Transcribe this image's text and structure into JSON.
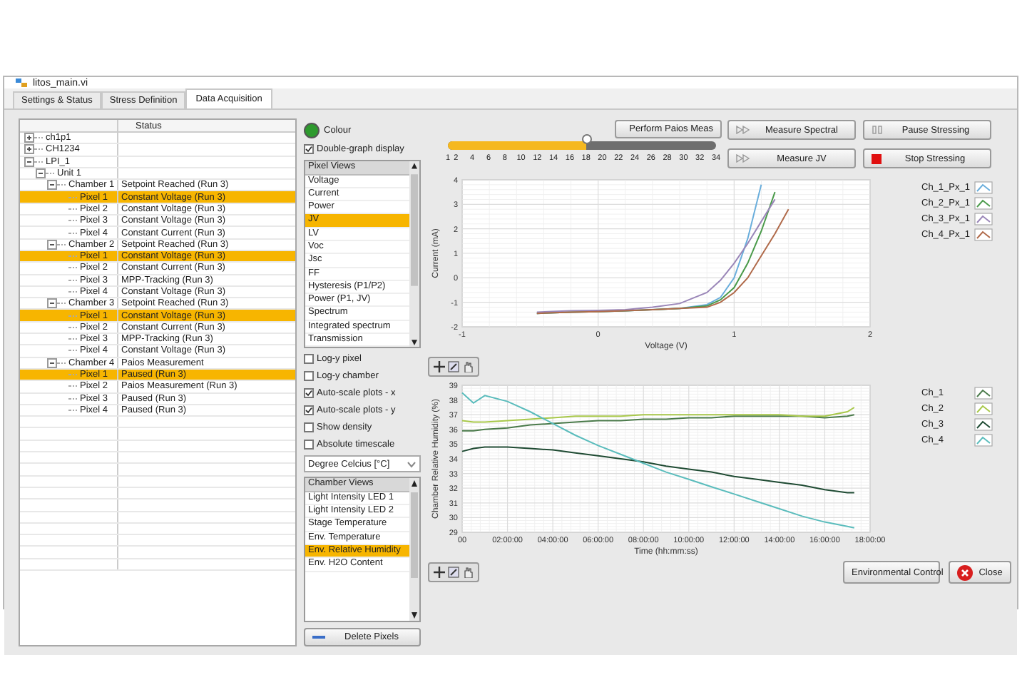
{
  "window": {
    "title": "litos_main.vi"
  },
  "tabs": [
    {
      "label": "Settings & Status",
      "selected": false
    },
    {
      "label": "Stress Definition",
      "selected": false
    },
    {
      "label": "Data Acquisition",
      "selected": true
    }
  ],
  "tree": {
    "columns": [
      "Status"
    ],
    "rows": [
      {
        "label": "ch1p1",
        "expanded": false,
        "selected": false
      },
      {
        "label": "CH1234",
        "expanded": false,
        "selected": false
      },
      {
        "label": "LPI_1",
        "expanded": true,
        "selected": false,
        "children": [
          {
            "label": "Unit 1",
            "expanded": true,
            "selected": false,
            "children": [
              {
                "label": "Chamber 1",
                "status": "Setpoint Reached (Run 3)",
                "expanded": true,
                "selected": false,
                "children": [
                  {
                    "label": "Pixel 1",
                    "status": "Constant Voltage (Run 3)",
                    "selected": true
                  },
                  {
                    "label": "Pixel 2",
                    "status": "Constant Voltage (Run 3)",
                    "selected": false
                  },
                  {
                    "label": "Pixel 3",
                    "status": "Constant Voltage (Run 3)",
                    "selected": false
                  },
                  {
                    "label": "Pixel 4",
                    "status": "Constant Current (Run 3)",
                    "selected": false
                  }
                ]
              },
              {
                "label": "Chamber 2",
                "status": "Setpoint Reached (Run 3)",
                "expanded": true,
                "selected": false,
                "children": [
                  {
                    "label": "Pixel 1",
                    "status": "Constant Voltage (Run 3)",
                    "selected": true
                  },
                  {
                    "label": "Pixel 2",
                    "status": "Constant Current (Run 3)",
                    "selected": false
                  },
                  {
                    "label": "Pixel 3",
                    "status": "MPP-Tracking (Run 3)",
                    "selected": false
                  },
                  {
                    "label": "Pixel 4",
                    "status": "Constant Voltage (Run 3)",
                    "selected": false
                  }
                ]
              },
              {
                "label": "Chamber 3",
                "status": "Setpoint Reached (Run 3)",
                "expanded": true,
                "selected": false,
                "children": [
                  {
                    "label": "Pixel 1",
                    "status": "Constant Voltage (Run 3)",
                    "selected": true
                  },
                  {
                    "label": "Pixel 2",
                    "status": "Constant Current (Run 3)",
                    "selected": false
                  },
                  {
                    "label": "Pixel 3",
                    "status": "MPP-Tracking (Run 3)",
                    "selected": false
                  },
                  {
                    "label": "Pixel 4",
                    "status": "Constant Voltage (Run 3)",
                    "selected": false
                  }
                ]
              },
              {
                "label": "Chamber 4",
                "status": "Paios Measurement",
                "expanded": true,
                "selected": false,
                "children": [
                  {
                    "label": "Pixel 1",
                    "status": "Paused (Run 3)",
                    "selected": true
                  },
                  {
                    "label": "Pixel 2",
                    "status": "Paios Measurement (Run 3)",
                    "selected": false
                  },
                  {
                    "label": "Pixel 3",
                    "status": "Paused (Run 3)",
                    "selected": false
                  },
                  {
                    "label": "Pixel 4",
                    "status": "Paused (Run 3)",
                    "selected": false
                  }
                ]
              }
            ]
          }
        ]
      }
    ]
  },
  "colour_indicator": {
    "label": "Colour",
    "on": true
  },
  "double_graph": {
    "label": "Double-graph display",
    "checked": true
  },
  "pixel_views": {
    "title": "Pixel Views",
    "items": [
      {
        "label": "Voltage",
        "selected": false
      },
      {
        "label": "Current",
        "selected": false
      },
      {
        "label": "Power",
        "selected": false
      },
      {
        "label": "JV",
        "selected": true
      },
      {
        "label": "LV",
        "selected": false
      },
      {
        "label": "Voc",
        "selected": false
      },
      {
        "label": "Jsc",
        "selected": false
      },
      {
        "label": "FF",
        "selected": false
      },
      {
        "label": "Hysteresis (P1/P2)",
        "selected": false
      },
      {
        "label": "Power (P1, JV)",
        "selected": false
      },
      {
        "label": "Spectrum",
        "selected": false
      },
      {
        "label": "Integrated spectrum",
        "selected": false
      },
      {
        "label": "Transmission",
        "selected": false
      }
    ]
  },
  "options": [
    {
      "label": "Log-y pixel",
      "checked": false
    },
    {
      "label": "Log-y chamber",
      "checked": false
    },
    {
      "label": "Auto-scale plots - x",
      "checked": true
    },
    {
      "label": "Auto-scale plots - y",
      "checked": true
    },
    {
      "label": "Show density",
      "checked": false
    },
    {
      "label": "Absolute timescale",
      "checked": false
    }
  ],
  "unit_dropdown": {
    "value": "Degree Celcius [°C]"
  },
  "chamber_views": {
    "title": "Chamber Views",
    "items": [
      {
        "label": "Light Intensity LED 1",
        "selected": false
      },
      {
        "label": "Light Intensity LED 2",
        "selected": false
      },
      {
        "label": "Stage Temperature",
        "selected": false
      },
      {
        "label": "Env. Temperature",
        "selected": false
      },
      {
        "label": "Env. Relative Humidity",
        "selected": true
      },
      {
        "label": "Env. H2O Content",
        "selected": false
      }
    ]
  },
  "delete_button": "Delete Pixels",
  "run_slider": {
    "level": 0.515,
    "ticks": [
      "1",
      "2",
      "4",
      "6",
      "8",
      "10",
      "12",
      "14",
      "16",
      "18",
      "20",
      "22",
      "24",
      "26",
      "28",
      "30",
      "32",
      "34"
    ]
  },
  "buttons": [
    {
      "label": "Perform Paios Meas",
      "kind": "paios"
    },
    {
      "label": "Measure Spectral",
      "kind": "measure"
    },
    {
      "label": "Pause Stressing",
      "kind": "pause"
    },
    {
      "label": "Measure JV",
      "kind": "measure"
    },
    {
      "label": "Stop Stressing",
      "kind": "stop"
    }
  ],
  "jv_graph": {
    "chart_data": {
      "type": "line",
      "grid": true,
      "xlabel": "Voltage (V)",
      "ylabel": "Current  (mA)",
      "x": [
        -0.45,
        -0.2,
        0,
        0.2,
        0.4,
        0.6,
        0.8,
        0.9,
        1.0,
        1.1,
        1.2,
        1.3,
        1.4
      ],
      "xlim": [
        -1,
        2
      ],
      "ylim": [
        -2,
        4
      ],
      "xticks": [
        -1,
        0,
        1,
        2
      ],
      "yticks": [
        -2,
        -1,
        0,
        1,
        2,
        3,
        4
      ],
      "series": [
        {
          "name": "Ch_1_Px_1",
          "color": "#6aaedc",
          "values": [
            -1.45,
            -1.4,
            -1.38,
            -1.35,
            -1.3,
            -1.25,
            -1.1,
            -0.8,
            0.0,
            1.6,
            3.8,
            null,
            null
          ]
        },
        {
          "name": "Ch_2_Px_1",
          "color": "#4a9a4a",
          "values": [
            -1.45,
            -1.4,
            -1.38,
            -1.35,
            -1.3,
            -1.25,
            -1.15,
            -0.9,
            -0.4,
            0.6,
            1.9,
            3.5,
            null
          ]
        },
        {
          "name": "Ch_3_Px_1",
          "color": "#9a86b8",
          "values": [
            -1.4,
            -1.35,
            -1.33,
            -1.3,
            -1.2,
            -1.05,
            -0.6,
            -0.1,
            0.6,
            1.4,
            2.3,
            3.2,
            null
          ]
        },
        {
          "name": "Ch_4_Px_1",
          "color": "#b06a4a",
          "values": [
            -1.45,
            -1.4,
            -1.38,
            -1.35,
            -1.3,
            -1.25,
            -1.2,
            -1.0,
            -0.6,
            0.0,
            0.9,
            1.8,
            2.8
          ]
        }
      ]
    }
  },
  "humidity_graph": {
    "chart_data": {
      "type": "line",
      "grid": true,
      "xlabel": "Time (hh:mm:ss)",
      "ylabel": "Chamber Relative Humidity (%)",
      "x": [
        0,
        0.5,
        1,
        2,
        3,
        4,
        5,
        6,
        7,
        8,
        9,
        10,
        11,
        12,
        13,
        14,
        15,
        16,
        17,
        17.3
      ],
      "xlim": [
        0,
        18
      ],
      "ylim": [
        29,
        39
      ],
      "xticks": [
        {
          "value": 0,
          "label": "00"
        },
        {
          "value": 2,
          "label": "02:00:00"
        },
        {
          "value": 4,
          "label": "04:00:00"
        },
        {
          "value": 6,
          "label": "06:00:00"
        },
        {
          "value": 8,
          "label": "08:00:00"
        },
        {
          "value": 10,
          "label": "10:00:00"
        },
        {
          "value": 12,
          "label": "12:00:00"
        },
        {
          "value": 14,
          "label": "14:00:00"
        },
        {
          "value": 16,
          "label": "16:00:00"
        },
        {
          "value": 18,
          "label": "18:00:00"
        }
      ],
      "yticks": [
        29,
        30,
        31,
        32,
        33,
        34,
        35,
        36,
        37,
        38,
        39
      ],
      "series": [
        {
          "name": "Ch_1",
          "color": "#4a7a4a",
          "values": [
            35.9,
            35.9,
            36.0,
            36.1,
            36.3,
            36.4,
            36.5,
            36.6,
            36.6,
            36.7,
            36.7,
            36.8,
            36.8,
            36.9,
            36.9,
            36.9,
            36.9,
            36.8,
            36.9,
            37.0
          ]
        },
        {
          "name": "Ch_2",
          "color": "#a8c84a",
          "values": [
            36.6,
            36.5,
            36.5,
            36.6,
            36.7,
            36.8,
            36.9,
            36.9,
            36.9,
            37.0,
            37.0,
            37.0,
            37.0,
            37.0,
            37.0,
            37.0,
            36.9,
            36.9,
            37.2,
            37.5
          ]
        },
        {
          "name": "Ch_3",
          "color": "#1e4a32",
          "values": [
            34.5,
            34.7,
            34.8,
            34.8,
            34.7,
            34.6,
            34.4,
            34.2,
            34.0,
            33.8,
            33.5,
            33.3,
            33.1,
            32.8,
            32.6,
            32.4,
            32.2,
            31.9,
            31.7,
            31.7
          ]
        },
        {
          "name": "Ch_4",
          "color": "#5abcbc",
          "values": [
            38.5,
            37.8,
            38.3,
            37.9,
            37.2,
            36.4,
            35.6,
            34.9,
            34.3,
            33.7,
            33.1,
            32.6,
            32.1,
            31.6,
            31.1,
            30.6,
            30.1,
            29.7,
            29.4,
            29.3
          ]
        }
      ]
    }
  },
  "bottom_buttons": [
    {
      "label": "Environmental Control",
      "kind": "plain"
    },
    {
      "label": "Close",
      "kind": "close"
    }
  ]
}
